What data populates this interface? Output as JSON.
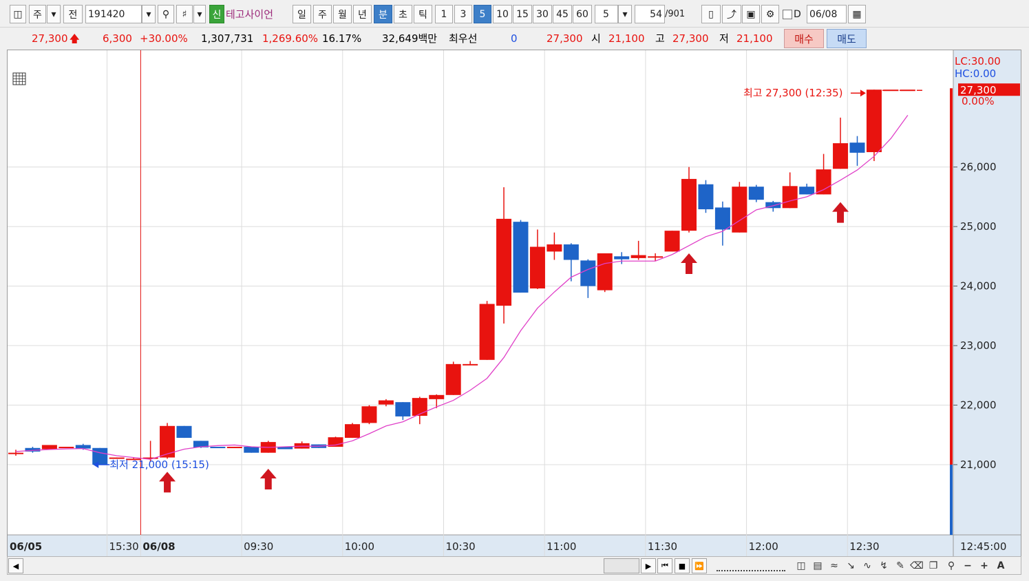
{
  "toolbar": {
    "layout_icon": "grid-layout-icon",
    "market": "주",
    "prev": "전",
    "code": "191420",
    "name": "테고사이언",
    "credit_badge": "신",
    "periods": [
      "일",
      "주",
      "월",
      "년",
      "분",
      "초",
      "틱"
    ],
    "active_period": "분",
    "intervals": [
      "1",
      "3",
      "5",
      "10",
      "15",
      "30",
      "45",
      "60"
    ],
    "active_interval": "5",
    "custom_interval": "5",
    "count_shown": "54",
    "count_total": "/901",
    "d_label": "D",
    "date": "06/08"
  },
  "quote": {
    "price": "27,300",
    "change": "6,300",
    "change_pct": "+30.00%",
    "volume": "1,307,731",
    "volume_ratio": "1,269.60%",
    "turnover": "16.17%",
    "amount": "32,649백만",
    "best_label": "최우선",
    "best_qty": "0",
    "best_price": "27,300",
    "open_label": "시",
    "open": "21,100",
    "high_label": "고",
    "high": "27,300",
    "low_label": "저",
    "low": "21,100",
    "buy_label": "매수",
    "sell_label": "매도"
  },
  "colors": {
    "up": "#e8130f",
    "down": "#1e64c8",
    "ma": "#e040c8",
    "grid": "#dcdcdc",
    "axis_bg": "#dde8f3"
  },
  "chart_data": {
    "type": "candlestick",
    "interval_minutes": 5,
    "ylim": [
      20000,
      27900
    ],
    "yticks": [
      21000,
      22000,
      23000,
      24000,
      25000,
      26000
    ],
    "ytick_labels": [
      "21,000",
      "22,000",
      "23,000",
      "24,000",
      "25,000",
      "26,000"
    ],
    "time_labels": [
      {
        "bar": -0.5,
        "text": "06/05",
        "bold": true
      },
      {
        "bar": 5.5,
        "text": "15:30",
        "bold": false
      },
      {
        "bar": 7.5,
        "text": "06/08",
        "bold": true
      },
      {
        "bar": 13.5,
        "text": "09:30",
        "bold": false
      },
      {
        "bar": 19.5,
        "text": "10:00",
        "bold": false
      },
      {
        "bar": 25.5,
        "text": "10:30",
        "bold": false
      },
      {
        "bar": 31.5,
        "text": "11:00",
        "bold": false
      },
      {
        "bar": 37.5,
        "text": "11:30",
        "bold": false
      },
      {
        "bar": 43.5,
        "text": "12:00",
        "bold": false
      },
      {
        "bar": 49.5,
        "text": "12:30",
        "bold": false
      }
    ],
    "end_time_label": "12:45:00",
    "session_divider_bar": 7.5,
    "lc_label": "LC:30.00",
    "hc_label": "HC:0.00",
    "current_price_label": "27,300",
    "current_pct_label": "0.00%",
    "high_annotation": {
      "text": "최고 27,300 (12:35)",
      "bar": 51,
      "value": 27300
    },
    "low_annotation": {
      "text": "최저 21,000 (15:15)",
      "bar": 5,
      "value": 21000
    },
    "signal_arrows": [
      {
        "bar": 9,
        "value": 20880
      },
      {
        "bar": 15,
        "value": 20930
      },
      {
        "bar": 40,
        "value": 24550
      },
      {
        "bar": 49,
        "value": 25410
      }
    ],
    "candles": [
      {
        "o": 21200,
        "h": 21250,
        "l": 21150,
        "c": 21200
      },
      {
        "o": 21280,
        "h": 21300,
        "l": 21200,
        "c": 21220
      },
      {
        "o": 21260,
        "h": 21300,
        "l": 21250,
        "c": 21330
      },
      {
        "o": 21300,
        "h": 21300,
        "l": 21300,
        "c": 21300
      },
      {
        "o": 21330,
        "h": 21350,
        "l": 21250,
        "c": 21270
      },
      {
        "o": 21280,
        "h": 21280,
        "l": 21000,
        "c": 21000
      },
      {
        "o": 21120,
        "h": 21120,
        "l": 21100,
        "c": 21120
      },
      {
        "o": 21100,
        "h": 21120,
        "l": 21100,
        "c": 21100
      },
      {
        "o": 21100,
        "h": 21400,
        "l": 21050,
        "c": 21120
      },
      {
        "o": 21120,
        "h": 21700,
        "l": 21100,
        "c": 21650
      },
      {
        "o": 21650,
        "h": 21650,
        "l": 21450,
        "c": 21450
      },
      {
        "o": 21400,
        "h": 21400,
        "l": 21280,
        "c": 21290
      },
      {
        "o": 21300,
        "h": 21300,
        "l": 21290,
        "c": 21290
      },
      {
        "o": 21300,
        "h": 21300,
        "l": 21280,
        "c": 21300
      },
      {
        "o": 21300,
        "h": 21300,
        "l": 21200,
        "c": 21200
      },
      {
        "o": 21200,
        "h": 21400,
        "l": 21200,
        "c": 21380
      },
      {
        "o": 21300,
        "h": 21300,
        "l": 21260,
        "c": 21260
      },
      {
        "o": 21270,
        "h": 21390,
        "l": 21270,
        "c": 21360
      },
      {
        "o": 21340,
        "h": 21340,
        "l": 21280,
        "c": 21280
      },
      {
        "o": 21300,
        "h": 21470,
        "l": 21300,
        "c": 21460
      },
      {
        "o": 21450,
        "h": 21700,
        "l": 21450,
        "c": 21680
      },
      {
        "o": 21700,
        "h": 22000,
        "l": 21680,
        "c": 21980
      },
      {
        "o": 22010,
        "h": 22100,
        "l": 21980,
        "c": 22080
      },
      {
        "o": 22050,
        "h": 22050,
        "l": 21750,
        "c": 21810
      },
      {
        "o": 21820,
        "h": 22140,
        "l": 21680,
        "c": 22120
      },
      {
        "o": 22100,
        "h": 22180,
        "l": 21950,
        "c": 22170
      },
      {
        "o": 22170,
        "h": 22730,
        "l": 22170,
        "c": 22690
      },
      {
        "o": 22690,
        "h": 22740,
        "l": 22670,
        "c": 22690
      },
      {
        "o": 22760,
        "h": 23750,
        "l": 22760,
        "c": 23700
      },
      {
        "o": 23670,
        "h": 25660,
        "l": 23370,
        "c": 25130
      },
      {
        "o": 25080,
        "h": 25110,
        "l": 23890,
        "c": 23890
      },
      {
        "o": 23960,
        "h": 24950,
        "l": 23950,
        "c": 24660
      },
      {
        "o": 24580,
        "h": 24900,
        "l": 24440,
        "c": 24700
      },
      {
        "o": 24700,
        "h": 24720,
        "l": 24080,
        "c": 24440
      },
      {
        "o": 24430,
        "h": 24450,
        "l": 23800,
        "c": 24000
      },
      {
        "o": 23930,
        "h": 24550,
        "l": 23900,
        "c": 24550
      },
      {
        "o": 24500,
        "h": 24570,
        "l": 24370,
        "c": 24450
      },
      {
        "o": 24470,
        "h": 24760,
        "l": 24440,
        "c": 24520
      },
      {
        "o": 24500,
        "h": 24550,
        "l": 24420,
        "c": 24500
      },
      {
        "o": 24580,
        "h": 24930,
        "l": 24580,
        "c": 24930
      },
      {
        "o": 24930,
        "h": 26000,
        "l": 24900,
        "c": 25800
      },
      {
        "o": 25710,
        "h": 25780,
        "l": 25230,
        "c": 25290
      },
      {
        "o": 25320,
        "h": 25420,
        "l": 24680,
        "c": 24950
      },
      {
        "o": 24900,
        "h": 25750,
        "l": 24900,
        "c": 25670
      },
      {
        "o": 25670,
        "h": 25700,
        "l": 25410,
        "c": 25450
      },
      {
        "o": 25410,
        "h": 25430,
        "l": 25250,
        "c": 25310
      },
      {
        "o": 25310,
        "h": 25910,
        "l": 25310,
        "c": 25680
      },
      {
        "o": 25670,
        "h": 25720,
        "l": 25540,
        "c": 25540
      },
      {
        "o": 25540,
        "h": 26220,
        "l": 25540,
        "c": 25960
      },
      {
        "o": 25970,
        "h": 26830,
        "l": 25970,
        "c": 26400
      },
      {
        "o": 26410,
        "h": 26520,
        "l": 26020,
        "c": 26240
      },
      {
        "o": 26250,
        "h": 27300,
        "l": 26100,
        "c": 27300
      },
      {
        "o": 27300,
        "h": 27300,
        "l": 27300,
        "c": 27300
      },
      {
        "o": 27300,
        "h": 27300,
        "l": 27300,
        "c": 27300
      }
    ],
    "ma": [
      21220,
      21240,
      21255,
      21265,
      21270,
      21200,
      21150,
      21120,
      21090,
      21180,
      21260,
      21300,
      21320,
      21330,
      21300,
      21290,
      21300,
      21310,
      21310,
      21330,
      21400,
      21520,
      21650,
      21720,
      21850,
      21970,
      22080,
      22250,
      22450,
      22800,
      23250,
      23630,
      23900,
      24150,
      24280,
      24380,
      24420,
      24420,
      24420,
      24530,
      24680,
      24830,
      24920,
      25100,
      25280,
      25350,
      25430,
      25500,
      25620,
      25780,
      25950,
      26180,
      26480,
      26870
    ]
  },
  "scroll": {
    "left_arrow": "left-arrow-icon",
    "tools": [
      "play-icon",
      "rewind-icon",
      "stop-icon",
      "fast-forward-icon"
    ]
  }
}
